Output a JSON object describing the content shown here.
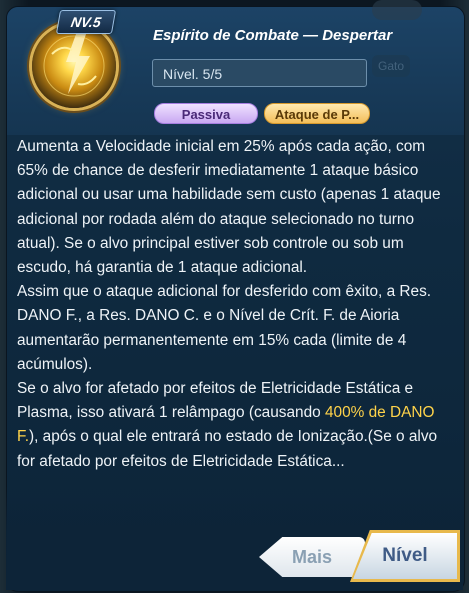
{
  "header": {
    "level_badge": "NV.5",
    "title": "Espírito de Combate — Despertar",
    "level_field": "Nível. 5/5",
    "ghost_button": "Gato"
  },
  "tags": {
    "passive": "Passiva",
    "attack": "Ataque de P..."
  },
  "description": {
    "p1": "Aumenta a Velocidade inicial em 25% após cada ação, com 65% de chance de desferir imediatamente 1 ataque básico adicional ou usar uma habilidade sem custo (apenas 1 ataque adicional por rodada além do ataque selecionado no turno atual). Se o alvo principal estiver sob controle ou sob um escudo, há garantia de 1 ataque adicional.",
    "p2": "Assim que o ataque adicional for desferido com êxito, a Res. DANO F., a Res. DANO C. e o Nível de Crít. F. de Aioria aumentarão permanentemente em 15% cada (limite de 4 acúmulos).",
    "p3_before": "Se o alvo for afetado por efeitos de Eletricidade Estática e Plasma, isso ativará 1 relâmpago (causando ",
    "p3_highlight": "400% de DANO F.",
    "p3_after": "), após o qual ele entrará no estado de Ionização.(Se o alvo for afetado por efeitos de Eletricidade Estática..."
  },
  "buttons": {
    "more": "Mais",
    "level": "Nível"
  },
  "colors": {
    "highlight": "#ffd34a",
    "panel": "#0f2a40",
    "accent_gold": "#e8b94c"
  }
}
